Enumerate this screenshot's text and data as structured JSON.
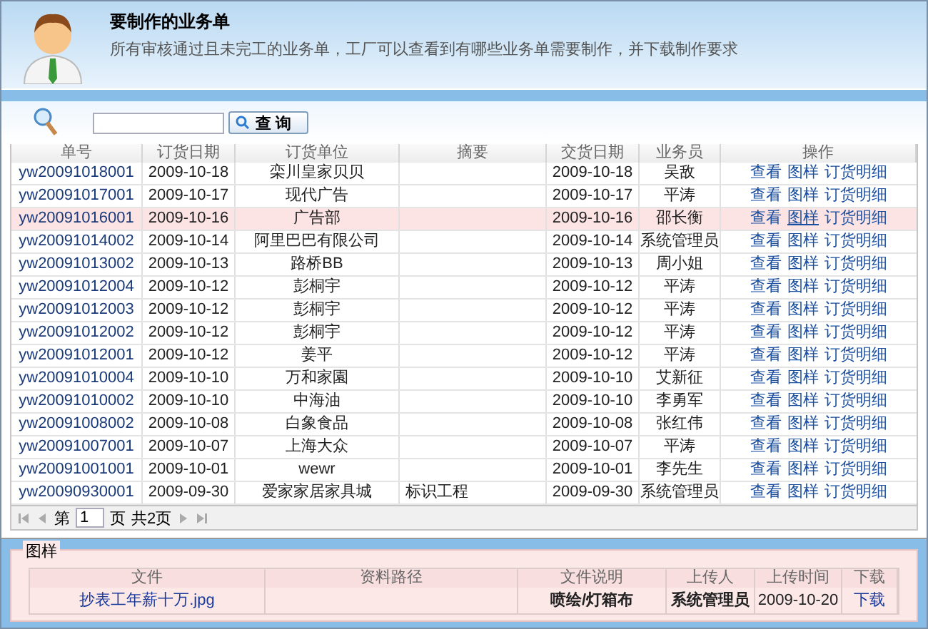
{
  "header": {
    "title": "要制作的业务单",
    "description": "所有审核通过且未完工的业务单，工厂可以查看到有哪些业务单需要制作，并下载制作要求"
  },
  "search": {
    "button": "查 询"
  },
  "table": {
    "columns": [
      "单号",
      "订货日期",
      "订货单位",
      "摘要",
      "交货日期",
      "业务员",
      "操作"
    ],
    "rows": [
      {
        "cells": [
          "yw20091018001",
          "2009-10-18",
          "栾川皇家贝贝",
          "",
          "2009-10-18",
          "吴敌"
        ],
        "actions": [
          "查看",
          "图样",
          "订货明细"
        ],
        "selected": false
      },
      {
        "cells": [
          "yw20091017001",
          "2009-10-17",
          "现代广告",
          "",
          "2009-10-17",
          "平涛"
        ],
        "actions": [
          "查看",
          "图样",
          "订货明细"
        ],
        "selected": false
      },
      {
        "cells": [
          "yw20091016001",
          "2009-10-16",
          "广告部",
          "",
          "2009-10-16",
          "邵长衡"
        ],
        "actions": [
          "查看",
          "图样",
          "订货明细"
        ],
        "selected": true
      },
      {
        "cells": [
          "yw20091014002",
          "2009-10-14",
          "阿里巴巴有限公司",
          "",
          "2009-10-14",
          "系统管理员"
        ],
        "actions": [
          "查看",
          "图样",
          "订货明细"
        ],
        "selected": false
      },
      {
        "cells": [
          "yw20091013002",
          "2009-10-13",
          "路桥BB",
          "",
          "2009-10-13",
          "周小姐"
        ],
        "actions": [
          "查看",
          "图样",
          "订货明细"
        ],
        "selected": false
      },
      {
        "cells": [
          "yw20091012004",
          "2009-10-12",
          "彭桐宇",
          "",
          "2009-10-12",
          "平涛"
        ],
        "actions": [
          "查看",
          "图样",
          "订货明细"
        ],
        "selected": false
      },
      {
        "cells": [
          "yw20091012003",
          "2009-10-12",
          "彭桐宇",
          "",
          "2009-10-12",
          "平涛"
        ],
        "actions": [
          "查看",
          "图样",
          "订货明细"
        ],
        "selected": false
      },
      {
        "cells": [
          "yw20091012002",
          "2009-10-12",
          "彭桐宇",
          "",
          "2009-10-12",
          "平涛"
        ],
        "actions": [
          "查看",
          "图样",
          "订货明细"
        ],
        "selected": false
      },
      {
        "cells": [
          "yw20091012001",
          "2009-10-12",
          "姜平",
          "",
          "2009-10-12",
          "平涛"
        ],
        "actions": [
          "查看",
          "图样",
          "订货明细"
        ],
        "selected": false
      },
      {
        "cells": [
          "yw20091010004",
          "2009-10-10",
          "万和家園",
          "",
          "2009-10-10",
          "艾新征"
        ],
        "actions": [
          "查看",
          "图样",
          "订货明细"
        ],
        "selected": false
      },
      {
        "cells": [
          "yw20091010002",
          "2009-10-10",
          "中海油",
          "",
          "2009-10-10",
          "李勇军"
        ],
        "actions": [
          "查看",
          "图样",
          "订货明细"
        ],
        "selected": false
      },
      {
        "cells": [
          "yw20091008002",
          "2009-10-08",
          "白象食品",
          "",
          "2009-10-08",
          "张红伟"
        ],
        "actions": [
          "查看",
          "图样",
          "订货明细"
        ],
        "selected": false
      },
      {
        "cells": [
          "yw20091007001",
          "2009-10-07",
          "上海大众",
          "",
          "2009-10-07",
          "平涛"
        ],
        "actions": [
          "查看",
          "图样",
          "订货明细"
        ],
        "selected": false
      },
      {
        "cells": [
          "yw20091001001",
          "2009-10-01",
          "wewr",
          "",
          "2009-10-01",
          "李先生"
        ],
        "actions": [
          "查看",
          "图样",
          "订货明细"
        ],
        "selected": false
      },
      {
        "cells": [
          "yw20090930001",
          "2009-09-30",
          "爱家家居家具城",
          "标识工程",
          "2009-09-30",
          "系统管理员"
        ],
        "actions": [
          "查看",
          "图样",
          "订货明细"
        ],
        "selected": false
      }
    ]
  },
  "pager": {
    "prefix": "第",
    "page": "1",
    "suffix": "页",
    "total": "共2页"
  },
  "attachments": {
    "legend": "图样",
    "columns": [
      "文件",
      "资料路径",
      "文件说明",
      "上传人",
      "上传时间",
      "下载"
    ],
    "rows": [
      {
        "file": "抄表工年薪十万.jpg",
        "path": "",
        "description": "喷绘/灯箱布",
        "uploader": "系统管理员",
        "time": "2009-10-20",
        "download": "下载"
      }
    ]
  }
}
